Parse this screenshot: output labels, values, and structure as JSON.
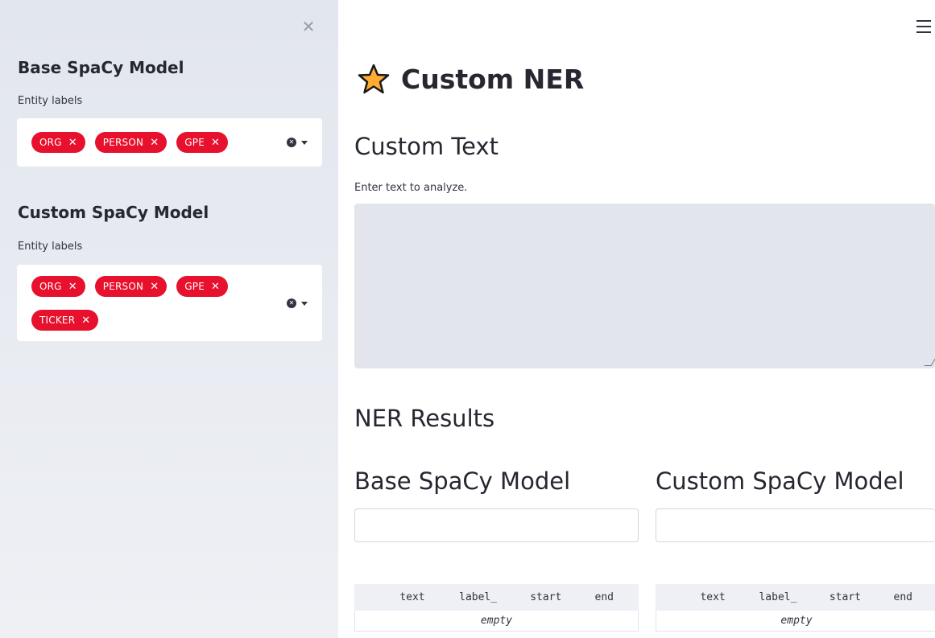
{
  "sidebar": {
    "close_icon": "close-icon",
    "base_model": {
      "title": "Base SpaCy Model",
      "field_label": "Entity labels",
      "selected": [
        "ORG",
        "PERSON",
        "GPE"
      ]
    },
    "custom_model": {
      "title": "Custom SpaCy Model",
      "field_label": "Entity labels",
      "selected": [
        "ORG",
        "PERSON",
        "GPE",
        "TICKER"
      ]
    },
    "chip_color": "#e8112d"
  },
  "header": {
    "menu_icon": "hamburger-menu-icon",
    "title_icon": "star-icon",
    "title": "Custom NER"
  },
  "main": {
    "custom_text_heading": "Custom Text",
    "textarea_label": "Enter text to analyze.",
    "textarea_value": "",
    "results_heading": "NER Results",
    "base": {
      "heading": "Base SpaCy Model",
      "input_value": "",
      "table": {
        "columns": [
          "text",
          "label_",
          "start",
          "end"
        ],
        "empty_text": "empty"
      }
    },
    "custom": {
      "heading": "Custom SpaCy Model",
      "input_value": "",
      "table": {
        "columns": [
          "text",
          "label_",
          "start",
          "end"
        ],
        "empty_text": "empty"
      }
    }
  }
}
